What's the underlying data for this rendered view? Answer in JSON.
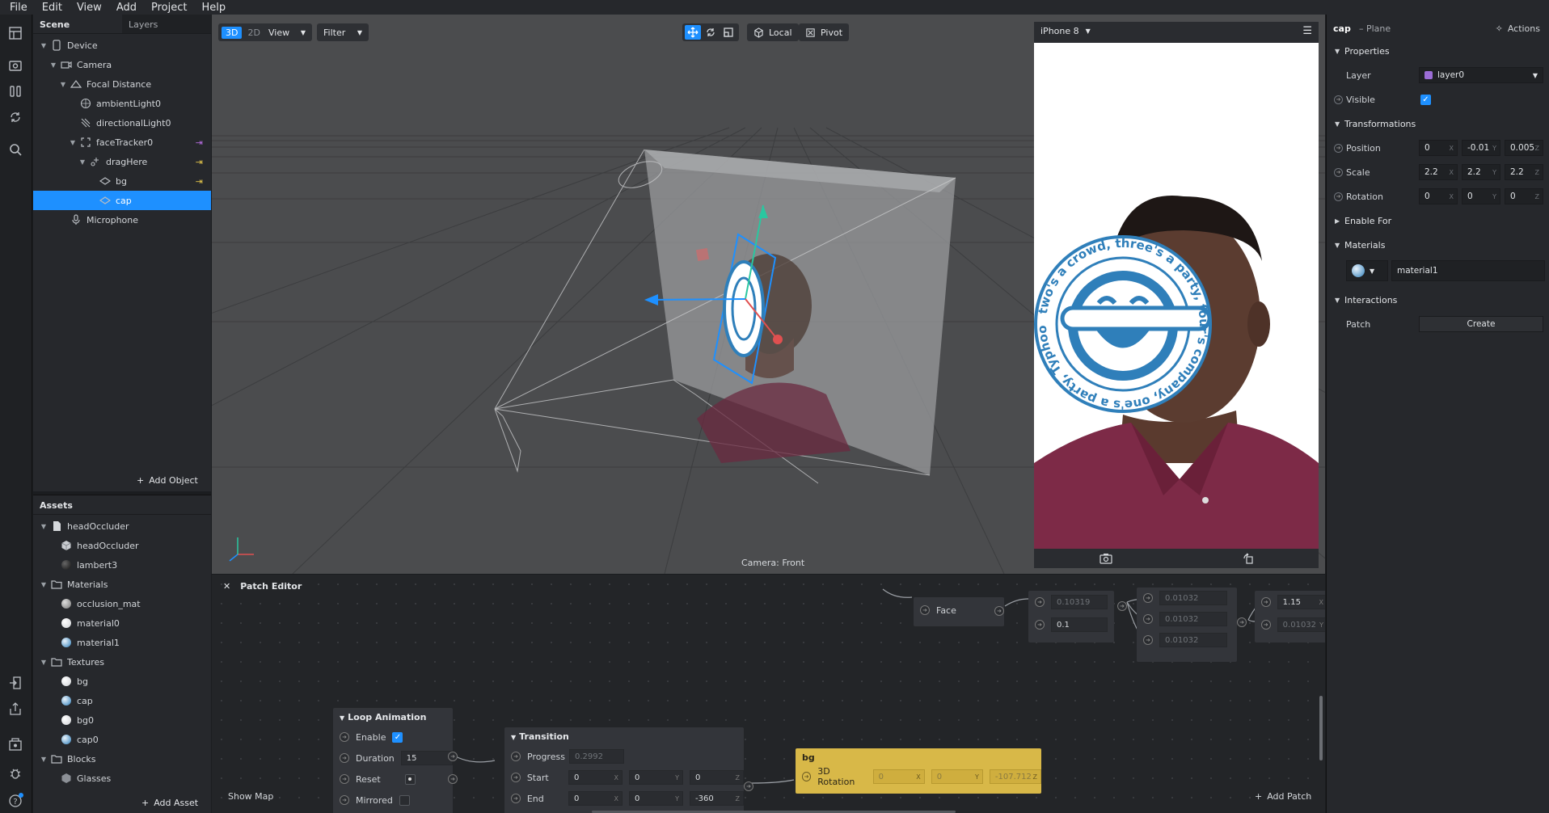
{
  "menu": [
    "File",
    "Edit",
    "View",
    "Add",
    "Project",
    "Help"
  ],
  "scene": {
    "tabs": [
      "Scene",
      "Layers"
    ],
    "items": [
      {
        "label": "Device",
        "depth": 0,
        "caret": "open",
        "icon": "device"
      },
      {
        "label": "Camera",
        "depth": 1,
        "caret": "open",
        "icon": "camera"
      },
      {
        "label": "Focal Distance",
        "depth": 2,
        "caret": "open",
        "icon": "focal"
      },
      {
        "label": "ambientLight0",
        "depth": 3,
        "caret": "",
        "icon": "ambient"
      },
      {
        "label": "directionalLight0",
        "depth": 3,
        "caret": "",
        "icon": "directional"
      },
      {
        "label": "faceTracker0",
        "depth": 3,
        "caret": "open",
        "icon": "facetracker",
        "link": "purple"
      },
      {
        "label": "dragHere",
        "depth": 4,
        "caret": "open",
        "icon": "null",
        "link": "yellow"
      },
      {
        "label": "bg",
        "depth": 5,
        "caret": "",
        "icon": "plane",
        "link": "yellow"
      },
      {
        "label": "cap",
        "depth": 5,
        "caret": "",
        "icon": "plane",
        "selected": true
      },
      {
        "label": "Microphone",
        "depth": 2,
        "caret": "",
        "icon": "mic"
      }
    ],
    "add_label": "Add Object"
  },
  "assets": {
    "title": "Assets",
    "items": [
      {
        "label": "headOccluder",
        "depth": 0,
        "caret": "open",
        "icon": "file"
      },
      {
        "label": "headOccluder",
        "depth": 1,
        "caret": "",
        "icon": "cube"
      },
      {
        "label": "lambert3",
        "depth": 1,
        "caret": "",
        "icon": "ball-dark"
      },
      {
        "label": "Materials",
        "depth": 0,
        "caret": "open",
        "icon": "folder"
      },
      {
        "label": "occlusion_mat",
        "depth": 1,
        "caret": "",
        "icon": "ball-grey"
      },
      {
        "label": "material0",
        "depth": 1,
        "caret": "",
        "icon": "ball-white"
      },
      {
        "label": "material1",
        "depth": 1,
        "caret": "",
        "icon": "ball-blue"
      },
      {
        "label": "Textures",
        "depth": 0,
        "caret": "open",
        "icon": "folder"
      },
      {
        "label": "bg",
        "depth": 1,
        "caret": "",
        "icon": "ball-white"
      },
      {
        "label": "cap",
        "depth": 1,
        "caret": "",
        "icon": "ball-blue"
      },
      {
        "label": "bg0",
        "depth": 1,
        "caret": "",
        "icon": "ball-white"
      },
      {
        "label": "cap0",
        "depth": 1,
        "caret": "",
        "icon": "ball-blue"
      },
      {
        "label": "Blocks",
        "depth": 0,
        "caret": "open",
        "icon": "folder"
      },
      {
        "label": "Glasses",
        "depth": 1,
        "caret": "",
        "icon": "block"
      }
    ],
    "add_label": "Add Asset"
  },
  "viewport": {
    "mode_3d": "3D",
    "mode_2d": "2D",
    "view_label": "View",
    "filter_label": "Filter",
    "local_label": "Local",
    "pivot_label": "Pivot",
    "camera_label": "Camera: Front"
  },
  "device": {
    "name": "iPhone 8",
    "sticker_text": "two's a crowd, three's a party, four's company, one's a party, Typhoon Ototo"
  },
  "patch": {
    "title": "Patch Editor",
    "show_map": "Show Map",
    "add_patch": "Add Patch",
    "face_label": "Face",
    "face_values": [
      "0.10319",
      "0.1"
    ],
    "mid_values": [
      "0.01032",
      "0.01032",
      "0.01032"
    ],
    "right_values": [
      "1.15",
      "0.01032"
    ],
    "loop": {
      "title": "Loop Animation",
      "enable_label": "Enable",
      "duration_label": "Duration",
      "duration": "15",
      "reset_label": "Reset",
      "mirrored_label": "Mirrored"
    },
    "transition": {
      "title": "Transition",
      "progress_label": "Progress",
      "progress": "0.2992",
      "start_label": "Start",
      "start": [
        "0",
        "0",
        "0"
      ],
      "end_label": "End",
      "end": [
        "0",
        "0",
        "-360"
      ]
    },
    "bg_node": {
      "title": "bg",
      "rot_label": "3D Rotation",
      "rot": [
        "0",
        "0",
        "-107.712"
      ]
    }
  },
  "inspector": {
    "object": "cap",
    "type": "– Plane",
    "actions": "Actions",
    "properties": "Properties",
    "layer_label": "Layer",
    "layer_value": "layer0",
    "visible_label": "Visible",
    "transformations": "Transformations",
    "position_label": "Position",
    "position": [
      "0",
      "-0.01",
      "0.005"
    ],
    "scale_label": "Scale",
    "scale": [
      "2.2",
      "2.2",
      "2.2"
    ],
    "rotation_label": "Rotation",
    "rotation": [
      "0",
      "0",
      "0"
    ],
    "enable_for": "Enable For",
    "materials": "Materials",
    "material_value": "material1",
    "interactions": "Interactions",
    "patch_label": "Patch",
    "create_label": "Create"
  },
  "colors": {
    "accent": "#1e90ff",
    "bg_node": "#d8b848",
    "sticker_blue": "#2f7fba",
    "shirt": "#7d2a47"
  }
}
